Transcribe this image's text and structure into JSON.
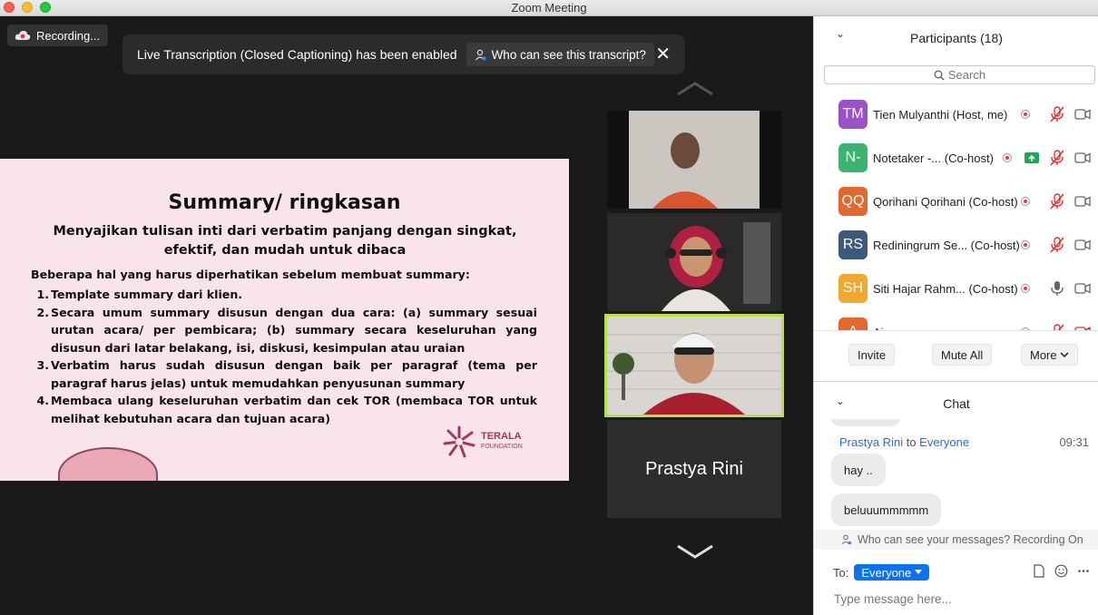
{
  "window": {
    "title": "Zoom Meeting"
  },
  "recording": {
    "label": "Recording..."
  },
  "banner": {
    "message": "Live Transcription (Closed Captioning) has been enabled",
    "who_label": "Who can see this transcript?"
  },
  "slide": {
    "title": "Summary/ ringkasan",
    "subtitle": "Menyajikan tulisan inti dari verbatim panjang dengan singkat,  efektif, dan mudah untuk dibaca",
    "lead": "Beberapa hal yang harus diperhatikan sebelum membuat summary:",
    "items": [
      {
        "num": "1.",
        "text": "Template summary dari klien."
      },
      {
        "num": "2.",
        "text": "Secara umum summary disusun dengan dua cara: (a) summary sesuai urutan acara/ per pembicara; (b) summary secara keseluruhan yang disusun dari latar belakang, isi, diskusi, kesimpulan atau uraian"
      },
      {
        "num": "3.",
        "text": "Verbatim harus sudah disusun dengan baik per paragraf (tema per paragraf harus jelas) untuk memudahkan penyusunan summary"
      },
      {
        "num": "4.",
        "text": "Membaca ulang keseluruhan verbatim dan cek TOR (membaca TOR untuk melihat kebutuhan acara dan tujuan acara)"
      }
    ],
    "logo_name": "TERALA",
    "logo_sub": "FOUNDATION"
  },
  "gallery": {
    "name_tile": "Prastya Rini"
  },
  "participants": {
    "title": "Participants (18)",
    "search_placeholder": "Search",
    "list": [
      {
        "initials": "TM",
        "name": "Tien Mulyanthi (Host, me)",
        "color": "#9b51c8",
        "mic": "muted",
        "share": false
      },
      {
        "initials": "N-",
        "name": "Notetaker -... (Co-host)",
        "color": "#3cb371",
        "mic": "muted",
        "share": true
      },
      {
        "initials": "QQ",
        "name": "Qorihani Qorihani (Co-host)",
        "color": "#e2692e",
        "mic": "muted",
        "share": false
      },
      {
        "initials": "RS",
        "name": "Rediningrum Se... (Co-host)",
        "color": "#3d5a7a",
        "mic": "muted",
        "share": false
      },
      {
        "initials": "SH",
        "name": "Siti Hajar Rahm...  (Co-host)",
        "color": "#f0a830",
        "mic": "on",
        "share": false
      },
      {
        "initials": "A",
        "name": "Ajay",
        "color": "#e2692e",
        "mic": "muted",
        "share": false
      }
    ],
    "buttons": {
      "invite": "Invite",
      "mute_all": "Mute All",
      "more": "More"
    }
  },
  "chat": {
    "title": "Chat",
    "sender": "Prastya Rini",
    "to_word": "to",
    "recipient": "Everyone",
    "time": "09:31",
    "messages": [
      "hay ..",
      "beluuummmmm"
    ],
    "note": "Who can see your messages? Recording On",
    "to_label": "To:",
    "to_value": "Everyone",
    "input_placeholder": "Type message here..."
  },
  "colors": {
    "accent": "#0e72ed",
    "active_speaker": "#b5e04a",
    "slide_bg": "#f9e4ee"
  }
}
